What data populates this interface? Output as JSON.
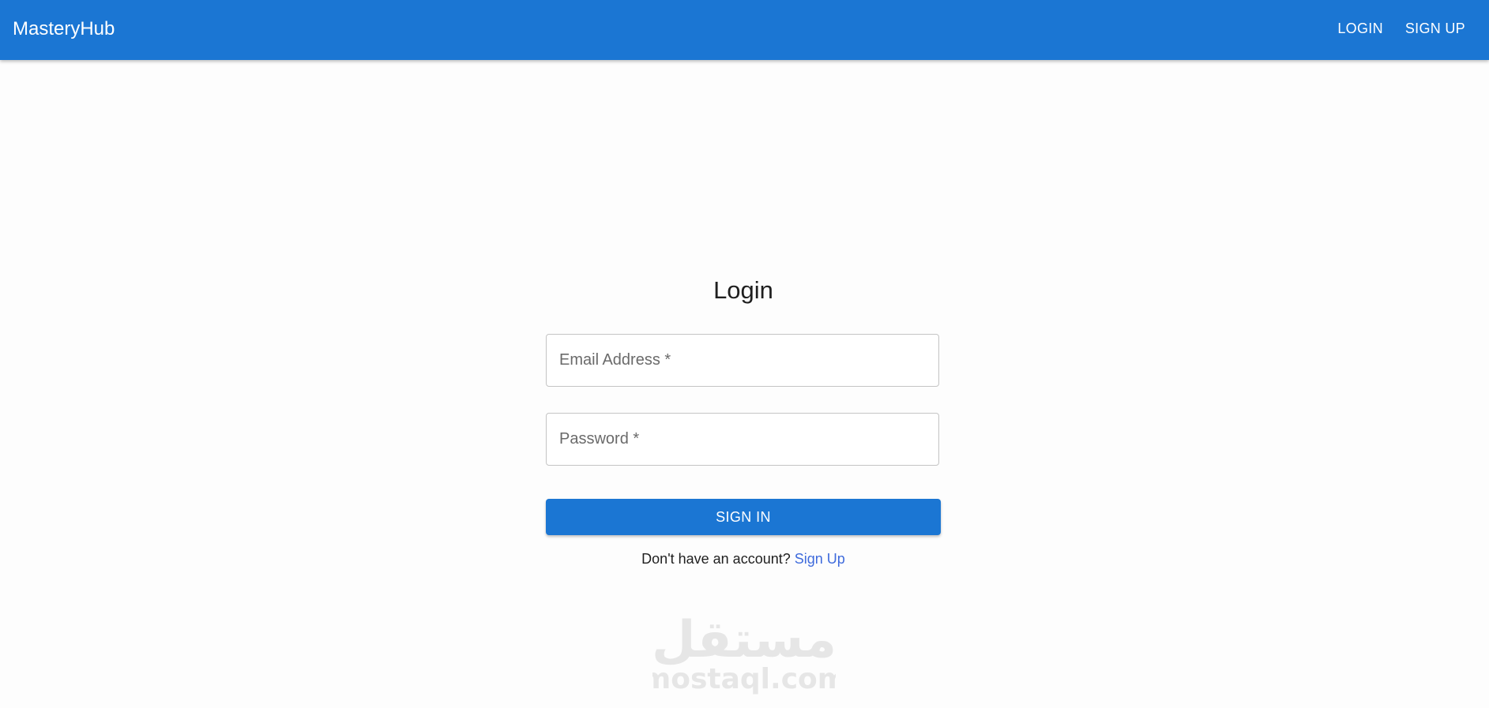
{
  "appbar": {
    "brand": "MasteryHub",
    "nav": [
      {
        "label": "LOGIN"
      },
      {
        "label": "SIGN UP"
      }
    ],
    "color": "#1b76d3"
  },
  "login": {
    "title": "Login",
    "email": {
      "placeholder": "Email Address *",
      "value": ""
    },
    "password": {
      "placeholder": "Password *",
      "value": ""
    },
    "submit_label": "SIGN IN",
    "prompt": "Don't have an account?",
    "signup_link": "Sign Up"
  },
  "watermark": {
    "arabic": "مستقل",
    "latin": "mostaql.com"
  },
  "colors": {
    "primary": "#1b76d3",
    "link": "#3f6bdc",
    "background": "#fdfdfd"
  }
}
